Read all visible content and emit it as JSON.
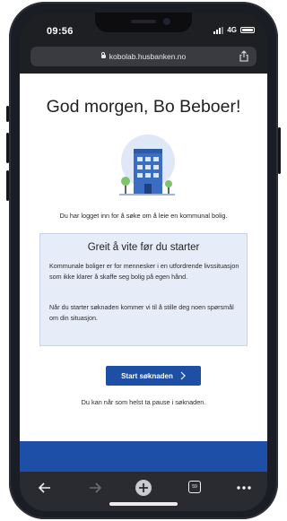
{
  "status_bar": {
    "time": "09:56",
    "network": "4G"
  },
  "browser": {
    "url": "kobolab.husbanken.no"
  },
  "page": {
    "greeting": "God morgen, Bo Beboer!",
    "intro": "Du har logget inn for å søke om å leie en kommunal bolig.",
    "info_box": {
      "title": "Greit å vite før du starter",
      "paragraph1": "Kommunale boliger er for mennesker i en utfordrende livssituasjon som ikke klarer å skaffe seg bolig på egen hånd.",
      "paragraph2": "Når du starter søknaden kommer vi til å stille deg noen spørsmål om din situasjon."
    },
    "start_button": "Start søknaden",
    "pause_note": "Du kan når som helst ta pause i søknaden."
  },
  "toolbar": {
    "icons": [
      "back-arrow-icon",
      "forward-arrow-icon",
      "new-tab-plus-icon",
      "tabs-icon",
      "more-icon"
    ],
    "tabs_count": "59"
  },
  "colors": {
    "brand_blue": "#1d4fa5",
    "info_bg": "#e6edf8"
  }
}
